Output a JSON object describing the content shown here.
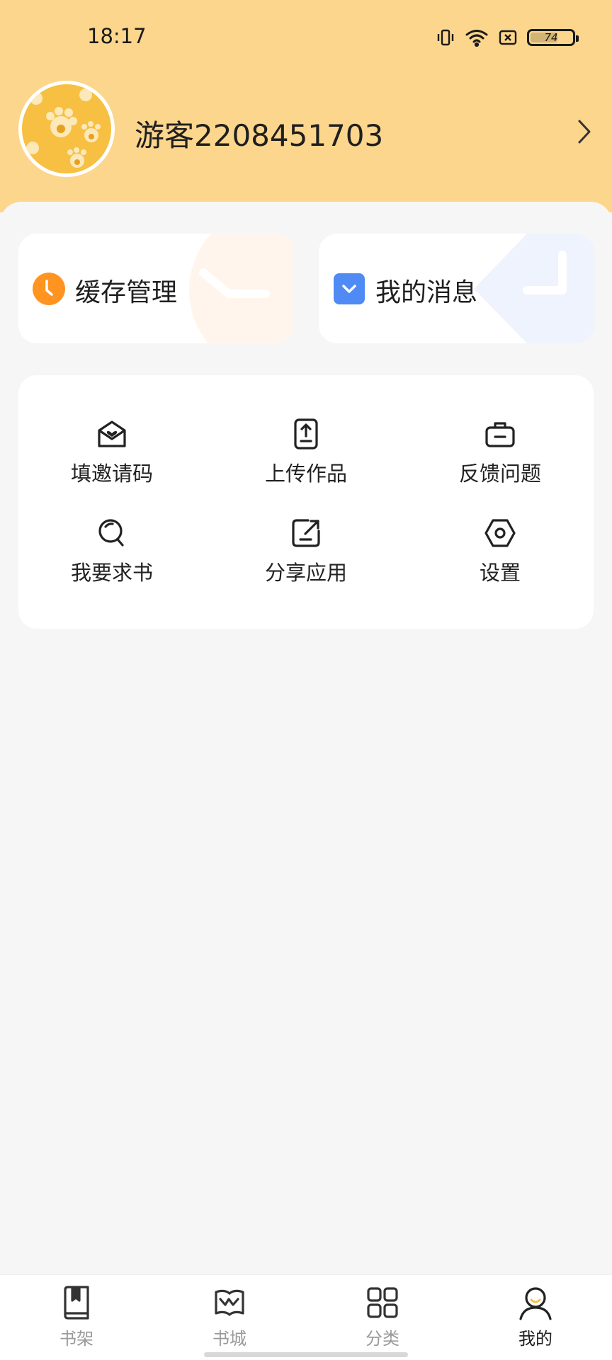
{
  "status_bar": {
    "time": "18:17",
    "battery": "74",
    "icons": [
      "vibrate-icon",
      "wifi-icon",
      "sim-off-icon",
      "battery-icon"
    ]
  },
  "profile": {
    "username": "游客2208451703",
    "avatar_color": "#f7c042",
    "arrow_icon": "chevron-right-icon"
  },
  "quick_actions": [
    {
      "label": "缓存管理",
      "icon": "clock-icon",
      "color": "#ff9421"
    },
    {
      "label": "我的消息",
      "icon": "message-check-icon",
      "color": "#4f8af5"
    }
  ],
  "menu_grid": [
    {
      "label": "填邀请码",
      "icon": "invite-envelope-icon"
    },
    {
      "label": "上传作品",
      "icon": "upload-icon"
    },
    {
      "label": "反馈问题",
      "icon": "feedback-briefcase-icon"
    },
    {
      "label": "我要求书",
      "icon": "search-book-icon"
    },
    {
      "label": "分享应用",
      "icon": "share-icon"
    },
    {
      "label": "设置",
      "icon": "settings-hexagon-icon"
    }
  ],
  "bottom_nav": [
    {
      "label": "书架",
      "icon": "bookshelf-icon",
      "active": false
    },
    {
      "label": "书城",
      "icon": "bookstore-icon",
      "active": false
    },
    {
      "label": "分类",
      "icon": "category-grid-icon",
      "active": false
    },
    {
      "label": "我的",
      "icon": "profile-icon",
      "active": true
    }
  ],
  "colors": {
    "header_bg": "#fcd68c",
    "page_bg": "#f6f6f6",
    "accent_orange": "#ff9421",
    "accent_blue": "#4f8af5"
  }
}
